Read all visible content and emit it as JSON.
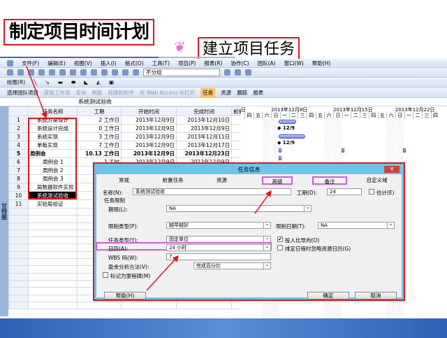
{
  "slide": {
    "title": "制定项目时间计划",
    "subtitle": "建立项目任务",
    "subtitle_icon": "pink-swirl-icon",
    "accent": "#e0161b"
  },
  "menu": [
    "文件(F)",
    "编辑(E)",
    "视图(V)",
    "插入(I)",
    "格式(O)",
    "工具(T)",
    "项目(P)",
    "报表(R)",
    "协作(C)",
    "团队(A)",
    "窗口(W)",
    "帮助(H)"
  ],
  "toolbar": {
    "group_select": "不分组",
    "draw": "绘图(R)",
    "team": [
      "选择团队项目",
      "获取工作项",
      "发布",
      "刷新",
      "链接和附件",
      "在 Web Access 中打开"
    ],
    "views": [
      "任务",
      "资源",
      "跟踪",
      "报表"
    ]
  },
  "formula_value": "系统测试验收",
  "sidebar_label": "甘特图",
  "table": {
    "headers": [
      "任务名称",
      "工期",
      "开始时间",
      "完成时间",
      "前置"
    ],
    "rows": [
      {
        "id": "1",
        "name": "系统方案设计",
        "dur": "2 工作日",
        "start": "2013年12月9日",
        "end": "2013年12月10日"
      },
      {
        "id": "2",
        "name": "系统设计完成",
        "dur": "0 工作日",
        "start": "2013年12月9日",
        "end": "2013年12月9日"
      },
      {
        "id": "3",
        "name": "系统实现",
        "dur": "3 工作日",
        "start": "2013年12月9日",
        "end": "2013年12月11日"
      },
      {
        "id": "4",
        "name": "单板实现",
        "dur": "7 工作日",
        "start": "2013年12月9日",
        "end": "2013年12月17日"
      },
      {
        "id": "5",
        "name": "周例会",
        "dur": "10.13 工作日",
        "start": "2013年12月9日",
        "end": "2013年12月23日"
      },
      {
        "id": "6",
        "name": "周例会 1",
        "dur": "1 工时",
        "start": "2013年12月9日",
        "end": "2013年12月9日"
      },
      {
        "id": "7",
        "name": "周例会 2",
        "dur": "",
        "start": "",
        "end": ""
      },
      {
        "id": "8",
        "name": "周例会 3",
        "dur": "",
        "start": "",
        "end": ""
      },
      {
        "id": "9",
        "name": "局数据软件实现",
        "dur": "",
        "start": "",
        "end": ""
      },
      {
        "id": "10",
        "name": "系统测试验收",
        "dur": "",
        "start": "",
        "end": ""
      },
      {
        "id": "11",
        "name": "实验局验证",
        "dur": "",
        "start": "",
        "end": ""
      }
    ]
  },
  "gantt": {
    "weeks": [
      "2013年12月8日",
      "2013年12月15日",
      "2013年12月22日"
    ],
    "lead_day": "日",
    "days": [
      "四",
      "五",
      "六",
      "日",
      "一",
      "二",
      "三",
      "四",
      "五",
      "六",
      "日",
      "一",
      "二",
      "三",
      "四",
      "五",
      "六",
      "日",
      "一",
      "二",
      "三",
      "四"
    ],
    "milestones": [
      "12/9",
      "12/9"
    ]
  },
  "dialog": {
    "title": "任务信息",
    "tabs": [
      "常规",
      "前置任务",
      "资源",
      "高级",
      "备注",
      "自定义域"
    ],
    "name_label": "名称(N):",
    "name_value": "系统测试验收",
    "duration_label": "工期(D):",
    "duration_value": "24",
    "estimated_label": "估计(E)",
    "constraints_group": "任务限制",
    "deadline_label": "期限(L):",
    "deadline_value": "NA",
    "constraint_type_label": "限制类型(P):",
    "constraint_type_value": "越早越好",
    "constraint_date_label": "限制日期(T):",
    "constraint_date_value": "NA",
    "task_type_label": "任务类型(Y):",
    "task_type_value": "固定单位",
    "effort_driven_label": "投入比导向(O)",
    "calendar_label": "日历(A):",
    "calendar_value": "24 小时",
    "ignore_resource_cal_label": "排定日程时忽略资源日历(G)",
    "wbs_label": "WBS 码(W):",
    "wbs_value": "7",
    "earned_value_label": "盈余分析方法(V):",
    "earned_value_value": "完成百分比",
    "milestone_label": "标记为里程碑(M)",
    "help": "帮助(H)",
    "ok": "确定",
    "cancel": "取消"
  }
}
